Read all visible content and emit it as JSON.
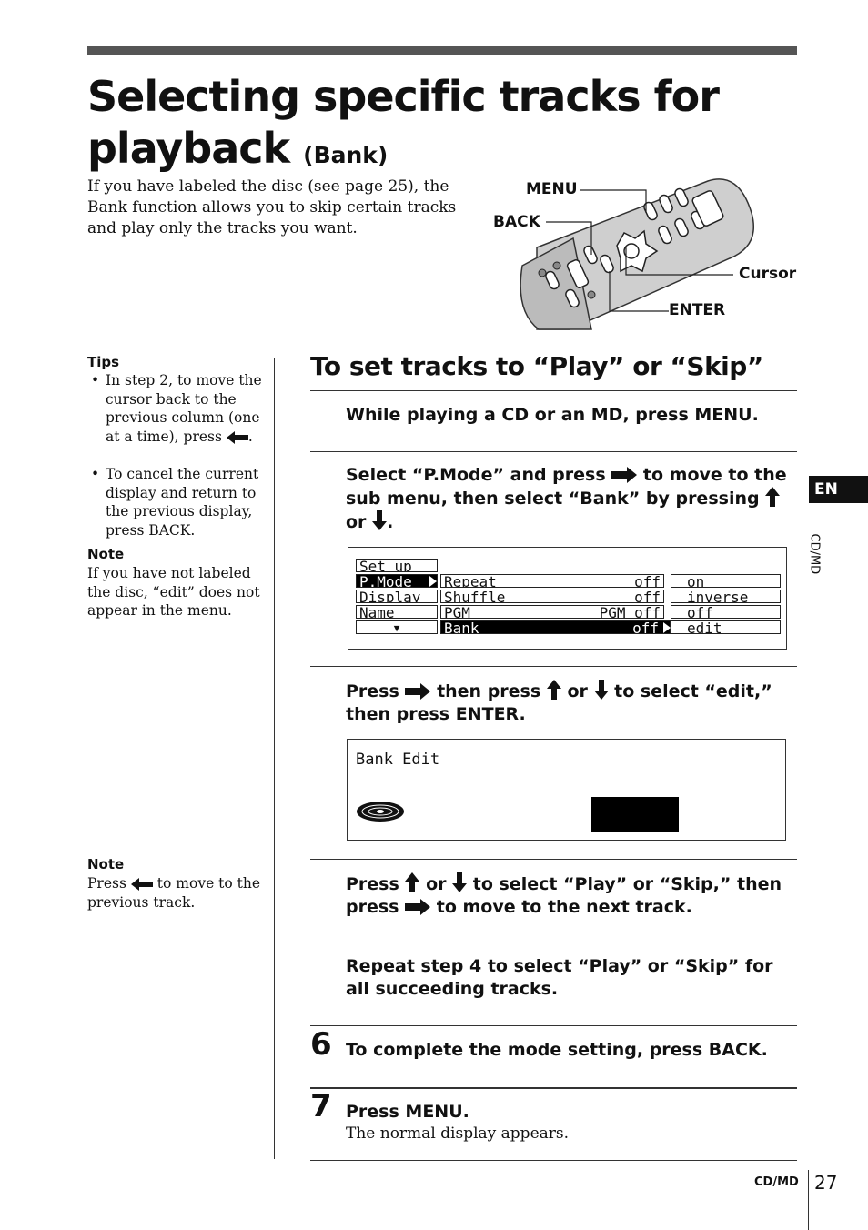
{
  "header": {
    "title_line1": "Selecting specific tracks for",
    "title_line2": "playback",
    "title_suffix": "(Bank)",
    "intro": "If you have labeled the disc (see page 25), the Bank function allows you to skip certain tracks and play only the tracks you want."
  },
  "remote_labels": {
    "menu": "MENU",
    "back": "BACK",
    "cursor": "Cursor",
    "enter": "ENTER"
  },
  "sidebar": {
    "tips_heading": "Tips",
    "tip1": "In step 2, to move the cursor back to the previous column (one at a time), press",
    "tip2": "To cancel the current display and return to the previous display, press BACK.",
    "note1_heading": "Note",
    "note1": "If you have not labeled the disc, “edit” does not appear in the menu.",
    "note2_heading": "Note",
    "note2_press": "Press",
    "note2_rest": "to move to the previous track."
  },
  "section": {
    "heading": "To set tracks to “Play” or “Skip”",
    "step1": "While playing a CD or an MD, press MENU.",
    "step2_a": "Select “P.Mode” and press",
    "step2_b": "to move to the sub menu, then select “Bank” by pressing",
    "step2_c": "or",
    "step2_d": ".",
    "step3_a": "Press",
    "step3_b": "then press",
    "step3_c": "or",
    "step3_d": "to select “edit,” then press ENTER.",
    "step4_a": "Press",
    "step4_b": "or",
    "step4_c": "to select “Play” or “Skip,” then press",
    "step4_d": "to move to the next track.",
    "step5": "Repeat step 4 to select “Play” or “Skip” for all succeeding tracks.",
    "step6_num": "6",
    "step6": "To complete the mode setting, press BACK.",
    "step7_num": "7",
    "step7": "Press MENU.",
    "step7_sub": "The normal display appears."
  },
  "lcd_menu": {
    "setup": "Set up",
    "pmode": "P.Mode",
    "display": "Display",
    "name": "Name",
    "down": "▼",
    "repeat": "Repeat",
    "repeat_val": "off",
    "shuffle": "Shuffle",
    "shuffle_val": "off",
    "pgm": "PGM",
    "pgm_val": "PGM off",
    "bank": "Bank",
    "bank_val": "off",
    "opt_on": "on",
    "opt_inverse": "inverse",
    "opt_off": "off",
    "opt_edit": "edit"
  },
  "lcd_bank": {
    "text": "Bank Edit"
  },
  "tabs": {
    "lang": "EN",
    "side_label": "CD/MD"
  },
  "footer": {
    "section": "CD/MD",
    "page": "27"
  }
}
